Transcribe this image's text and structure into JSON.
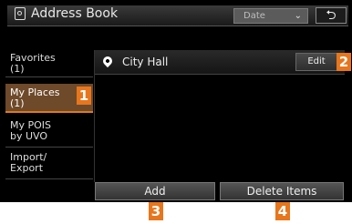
{
  "header": {
    "title": "Address Book",
    "sort_placeholder": "Date",
    "sort_caret": "⌄",
    "back_glyph": "⮌"
  },
  "sidebar": {
    "items": [
      {
        "label_line1": "Favorites",
        "label_line2": "(1)",
        "selected": false
      },
      {
        "label_line1": "My Places",
        "label_line2": "(1)",
        "selected": true
      },
      {
        "label_line1": "My POIS",
        "label_line2": "by UVO",
        "selected": false
      },
      {
        "label_line1": "Import/",
        "label_line2": "Export",
        "selected": false
      }
    ]
  },
  "list": {
    "rows": [
      {
        "label": "City Hall",
        "edit_label": "Edit",
        "icon": "pin-icon"
      }
    ]
  },
  "footer": {
    "add_label": "Add",
    "delete_label": "Delete Items"
  },
  "callouts": [
    "1",
    "2",
    "3",
    "4"
  ],
  "colors": {
    "accent": "#e8761c",
    "selected_bg": "#6e4a2a",
    "screen_bg": "#000000"
  }
}
